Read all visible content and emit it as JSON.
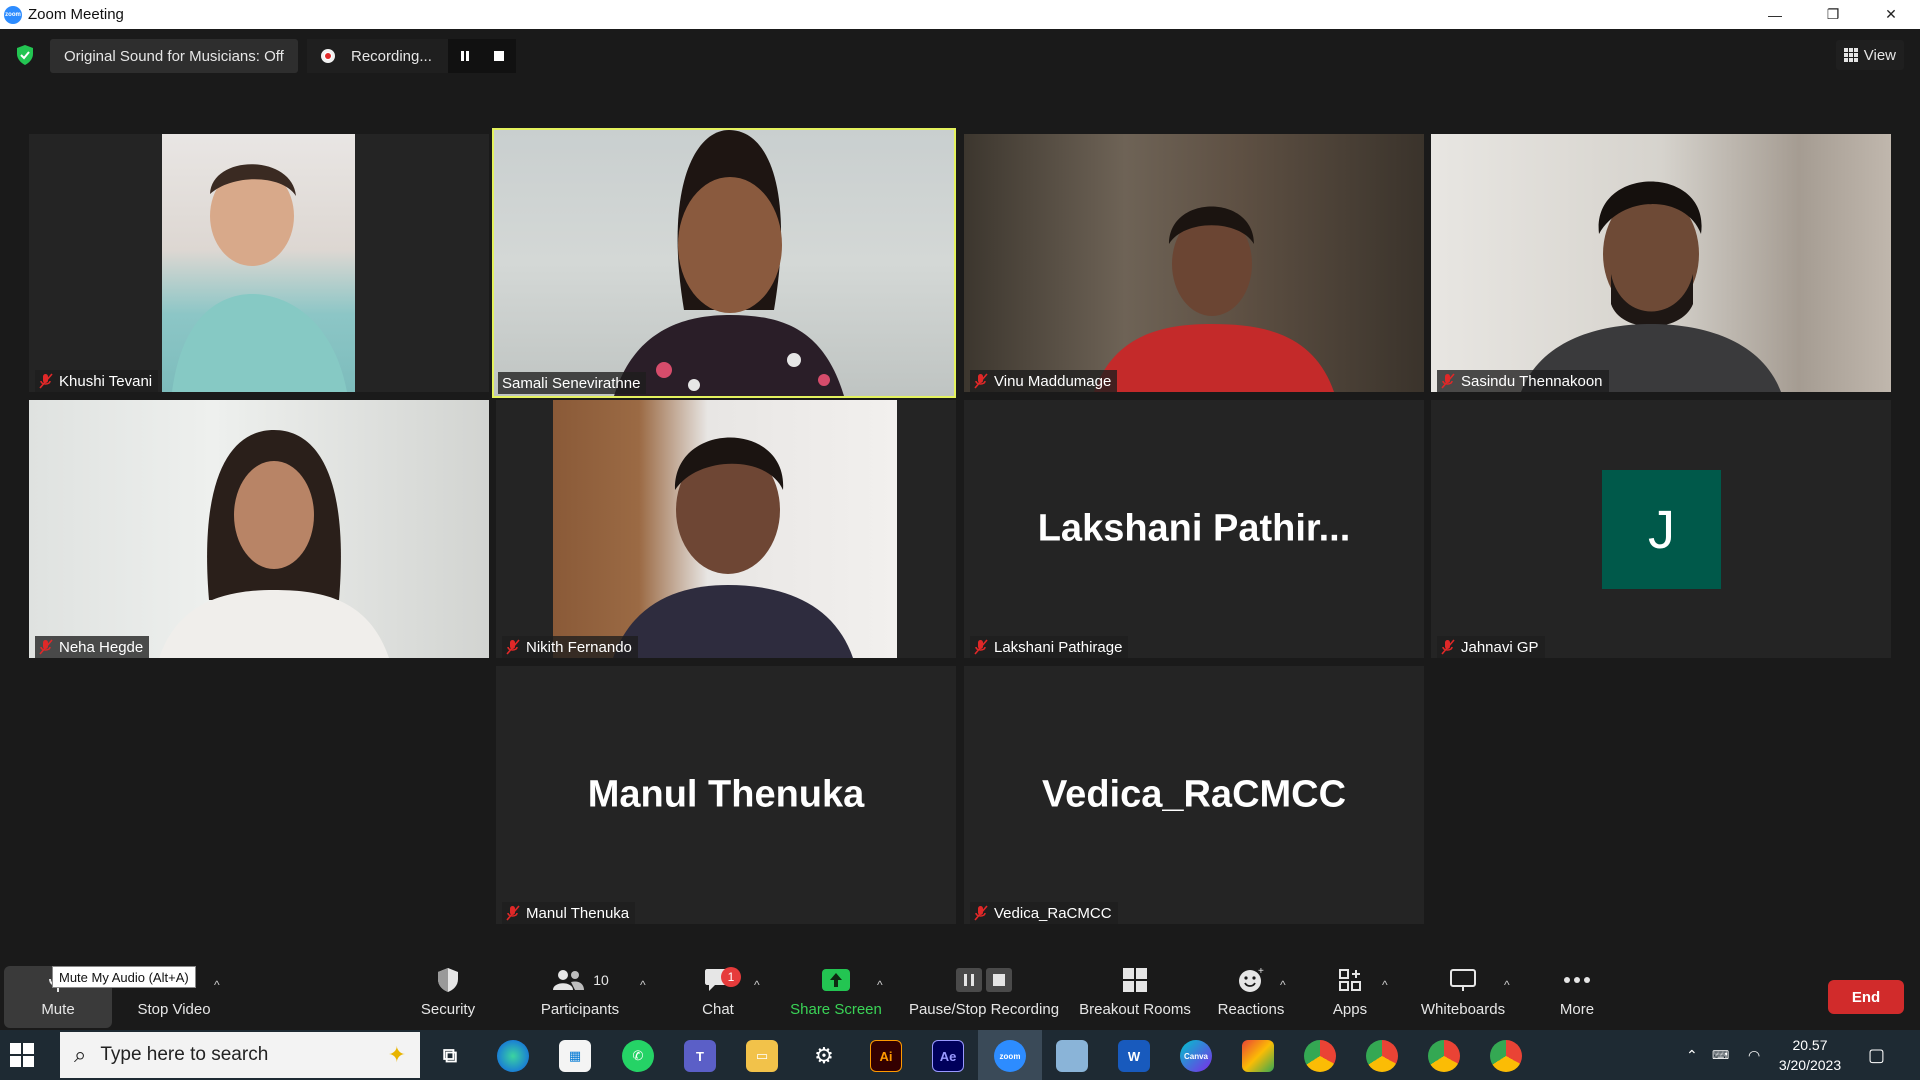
{
  "window": {
    "title": "Zoom Meeting",
    "controls": [
      "—",
      "❐",
      "✕"
    ]
  },
  "topbar": {
    "original_sound": "Original Sound for Musicians: Off",
    "recording_label": "Recording...",
    "view_label": "View"
  },
  "participants": [
    {
      "name": "Khushi Tevani",
      "muted": true
    },
    {
      "name": "Samali Senevirathne",
      "muted": false,
      "active_speaker": true
    },
    {
      "name": "Vinu Maddumage",
      "muted": true
    },
    {
      "name": "Sasindu Thennakoon",
      "muted": true
    },
    {
      "name": "Neha Hegde",
      "muted": true
    },
    {
      "name": "Nikith Fernando",
      "muted": true
    },
    {
      "name": "Lakshani Pathirage",
      "muted": true,
      "display_name": "Lakshani  Pathir..."
    },
    {
      "name": "Jahnavi GP",
      "muted": true,
      "avatar_letter": "J",
      "avatar_color": "#00594a"
    },
    {
      "name": "Manul Thenuka",
      "muted": true,
      "display_name": "Manul Thenuka"
    },
    {
      "name": "Vedica_RaCMCC",
      "muted": true,
      "display_name": "Vedica_RaCMCC"
    }
  ],
  "toolbar": {
    "mute": "Mute",
    "mute_tooltip": "Mute My Audio (Alt+A)",
    "stop_video": "Stop Video",
    "security": "Security",
    "participants": "Participants",
    "participants_count": "10",
    "chat": "Chat",
    "chat_badge": "1",
    "share_screen": "Share Screen",
    "pause_stop_recording": "Pause/Stop Recording",
    "breakout_rooms": "Breakout Rooms",
    "reactions": "Reactions",
    "apps": "Apps",
    "whiteboards": "Whiteboards",
    "more": "More",
    "end": "End"
  },
  "taskbar": {
    "search_placeholder": "Type here to search",
    "apps": [
      "Edge",
      "Store",
      "WhatsApp",
      "Teams",
      "File Explorer",
      "Settings",
      "Illustrator",
      "After Effects",
      "Zoom",
      "Notes",
      "Word",
      "Canva",
      "Office",
      "Chrome",
      "Chrome",
      "Chrome",
      "Chrome"
    ],
    "illustrator_label": "Ai",
    "aftereffects_label": "Ae",
    "word_label": "W",
    "zoom_label": "zoom",
    "canva_label": "Canva",
    "time": "20.57",
    "date": "3/20/2023"
  },
  "colors": {
    "active_speaker_border": "#e4f25e",
    "end_button": "#d12b2b",
    "share_screen": "#3ad356",
    "taskbar_bg": "#1e2a33"
  }
}
